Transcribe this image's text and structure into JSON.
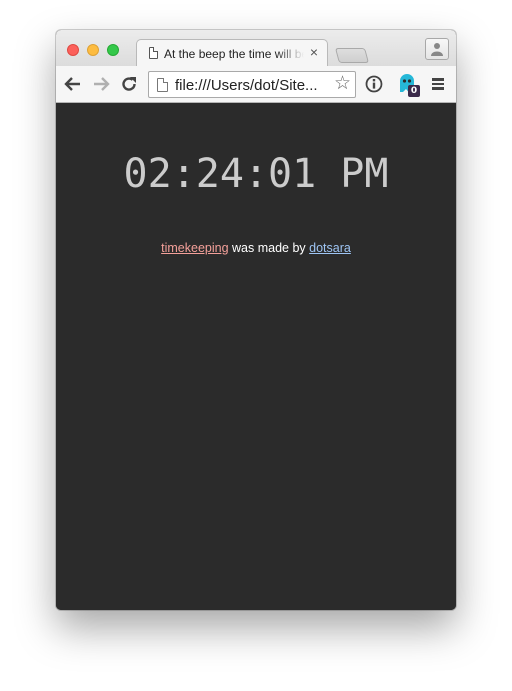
{
  "browser": {
    "tab_title": "At the beep the time will be",
    "tab_close": "×",
    "url": "file:///Users/dot/Sites/timekeeping/index.html",
    "url_display": "file:///Users/dot/Site...",
    "star_glyph": "☆",
    "extension_badge": "0",
    "icons": {
      "back": "arrow-left-icon",
      "forward": "arrow-right-icon",
      "reload": "reload-icon",
      "page": "page-icon",
      "bookmark": "star-icon",
      "info": "info-icon",
      "ghostery": "ghost-icon",
      "menu": "hamburger-menu-icon",
      "profile": "person-icon"
    }
  },
  "page": {
    "clock": "02:24:01 PM",
    "credit_link_project": "timekeeping",
    "credit_middle": " was made by ",
    "credit_link_author": "dotsara"
  },
  "colors": {
    "background": "#2b2b2b",
    "clock_text": "#cccccc",
    "link_project": "#f4a09a",
    "link_author": "#9ec5f4",
    "ghost_icon": "#26b8d8"
  }
}
